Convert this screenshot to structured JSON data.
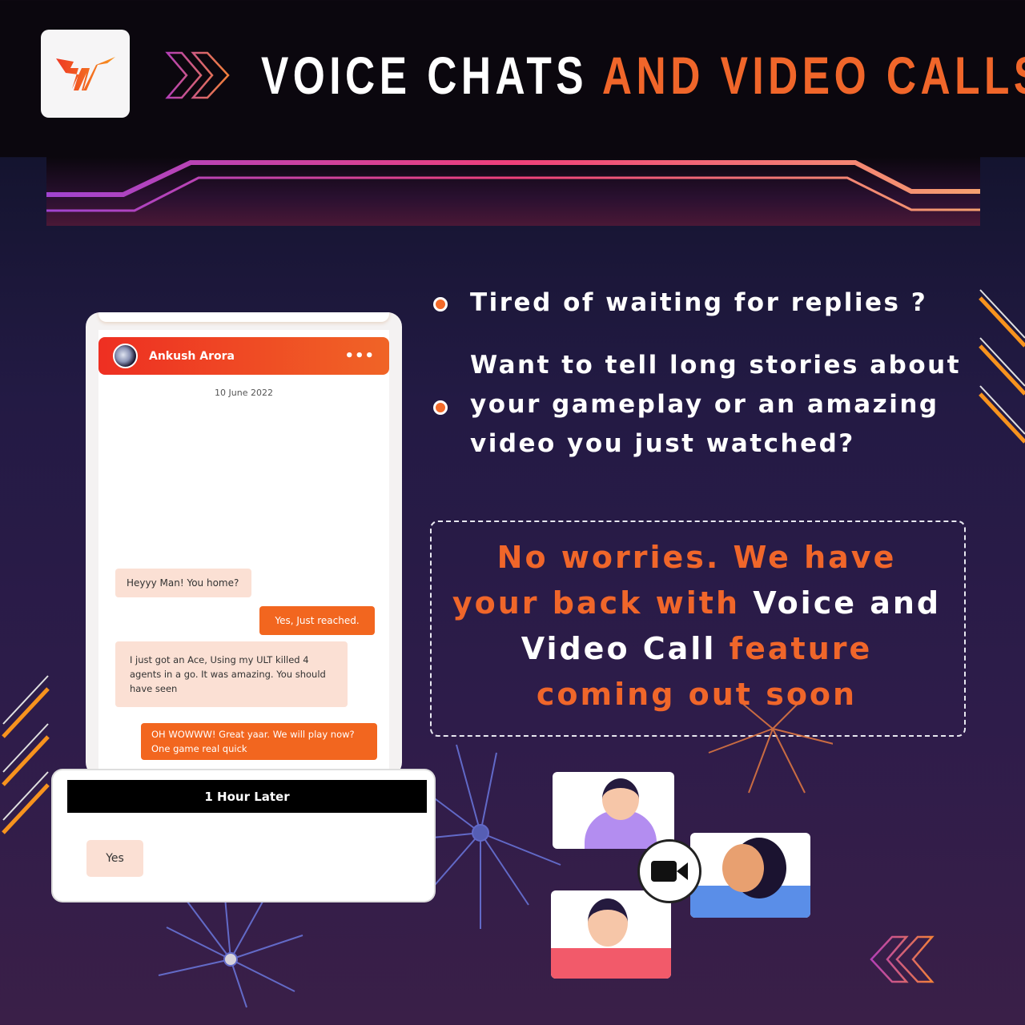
{
  "header": {
    "title_white": "VOICE CHATS",
    "title_orange": "AND VIDEO CALLS",
    "logo": "brand-logo"
  },
  "bullets": [
    {
      "text": "Tired of waiting for replies ?"
    },
    {
      "lines": [
        "Want to tell long stories about",
        "your gameplay or an amazing",
        "video you just watched?"
      ]
    }
  ],
  "callout": {
    "p1": "No worries. We have your back with ",
    "p2": "Voice and Video Call",
    "p3": " feature coming out soon"
  },
  "chat": {
    "contact": "Ankush Arora",
    "more": "•••",
    "date": "10 June 2022",
    "messages": [
      {
        "dir": "in",
        "text": "Heyyy Man!  You home?"
      },
      {
        "dir": "out",
        "text": "Yes, Just reached."
      },
      {
        "dir": "in",
        "text": "I just got an Ace, Using my ULT killed 4 agents in a go. It was amazing. You should have seen"
      },
      {
        "dir": "out",
        "text": "OH WOWWW! Great yaar. We will play now? One game real quick"
      }
    ]
  },
  "later": {
    "label": "1 Hour Later",
    "reply": "Yes"
  },
  "colors": {
    "accent": "#f0662a",
    "bg": "#231a44"
  }
}
